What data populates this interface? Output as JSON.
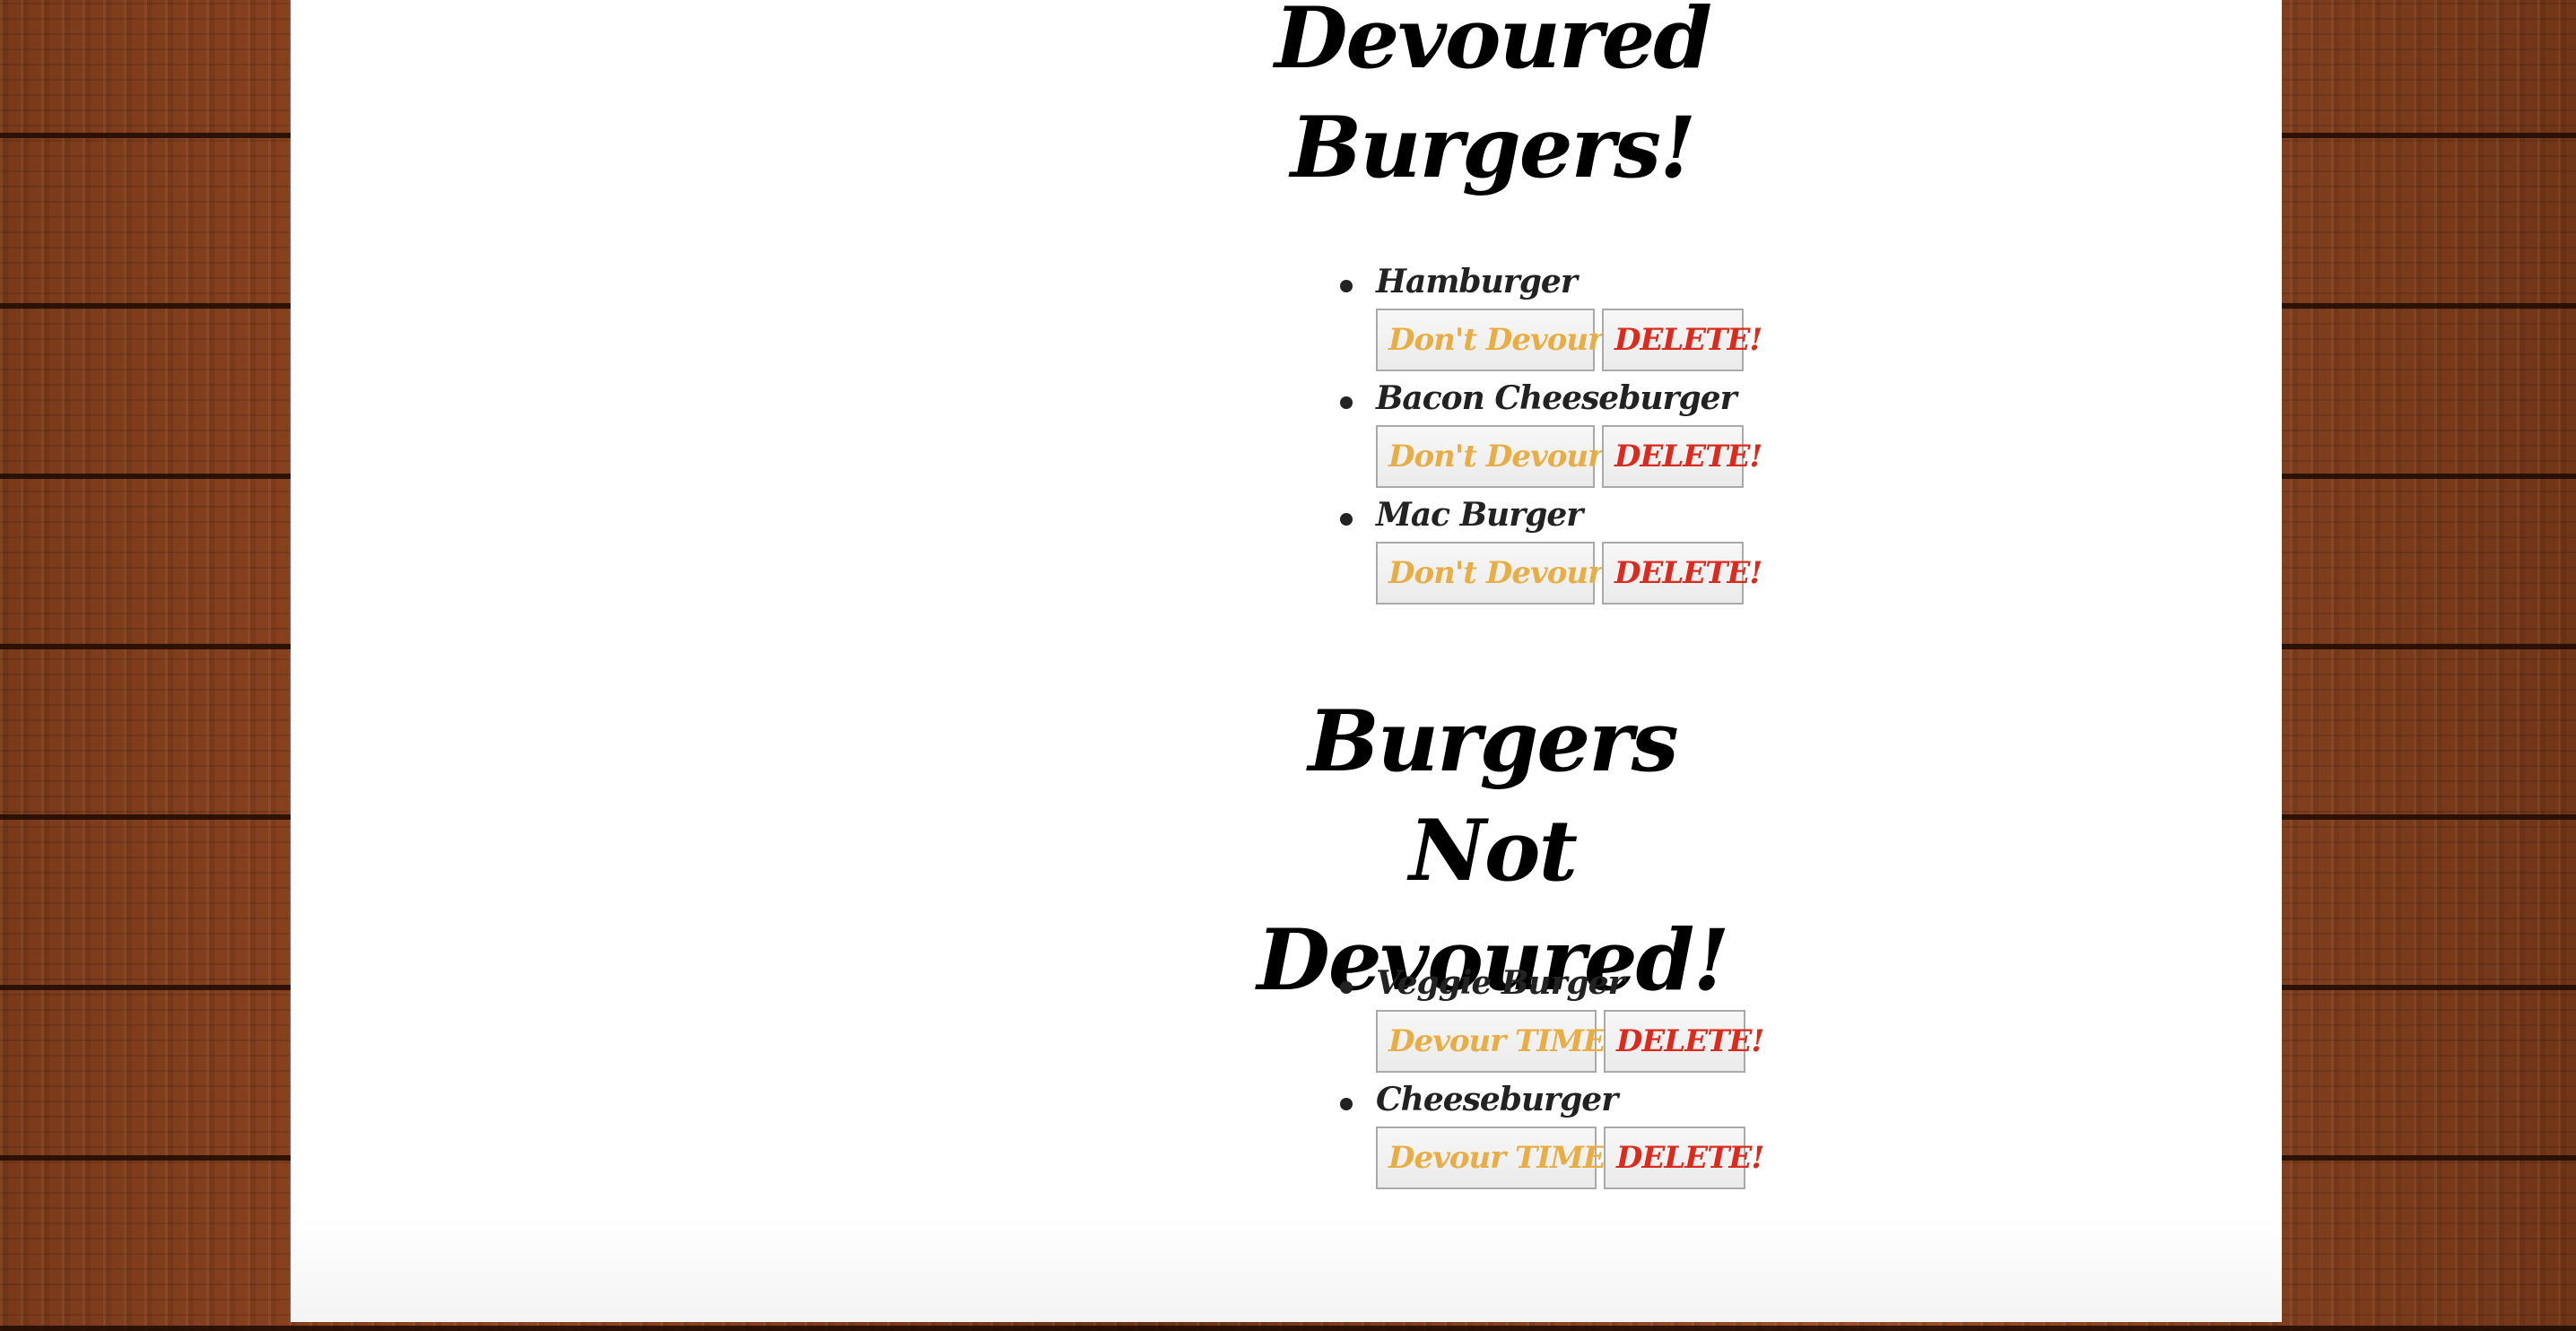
{
  "devoured_section": {
    "heading": "Devoured Burgers!",
    "items": [
      {
        "name": "Hamburger",
        "action_label": "Don't Devour!",
        "delete_label": "DELETE!"
      },
      {
        "name": "Bacon Cheeseburger",
        "action_label": "Don't Devour!",
        "delete_label": "DELETE!"
      },
      {
        "name": "Mac Burger",
        "action_label": "Don't Devour!",
        "delete_label": "DELETE!"
      }
    ]
  },
  "not_devoured_section": {
    "heading": "Burgers Not Devoured!",
    "items": [
      {
        "name": "Veggie Burger",
        "action_label": "Devour TIME!",
        "delete_label": "DELETE!"
      },
      {
        "name": "Cheeseburger",
        "action_label": "Devour TIME!",
        "delete_label": "DELETE!"
      }
    ]
  },
  "colors": {
    "devour_button_text": "#e8ae45",
    "delete_button_text": "#d92c1f",
    "panel_background": "#ffffff",
    "wood_background": "#7a3a1a"
  }
}
